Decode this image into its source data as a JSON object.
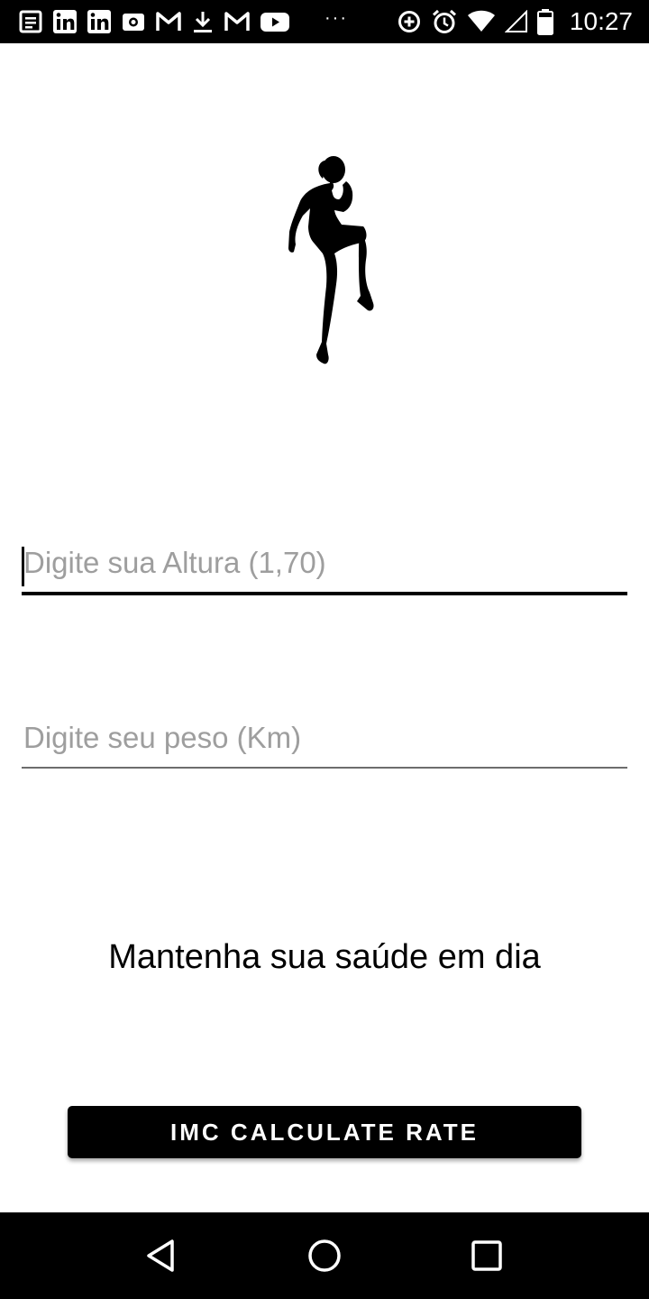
{
  "status_bar": {
    "left_icons": [
      "news-icon",
      "linkedin-icon",
      "linkedin-icon",
      "camera-icon",
      "gmail-icon",
      "download-icon",
      "gmail-icon",
      "youtube-icon"
    ],
    "overflow": "···",
    "right_icons": [
      "data-saver-icon",
      "alarm-icon",
      "wifi-icon",
      "signal-icon",
      "battery-icon"
    ],
    "time": "10:27"
  },
  "form": {
    "height_placeholder": "Digite sua Altura (1,70)",
    "weight_placeholder": "Digite seu peso (Km)"
  },
  "tagline": "Mantenha sua saúde em dia",
  "button": {
    "label": "IMC CALCULATE RATE"
  },
  "nav": {
    "icons": [
      "back-icon",
      "home-icon",
      "recents-icon"
    ]
  }
}
